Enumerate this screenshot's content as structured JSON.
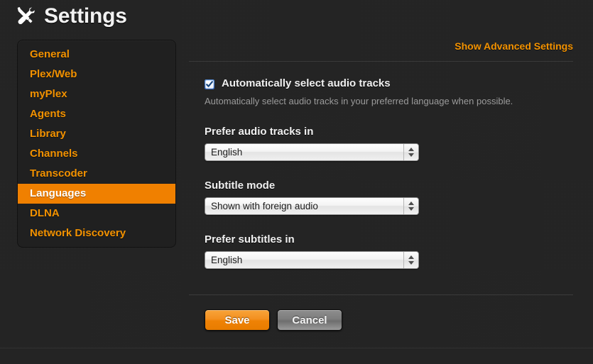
{
  "header": {
    "icon": "tools-icon",
    "title": "Settings"
  },
  "sidebar": {
    "items": [
      {
        "label": "General",
        "active": false
      },
      {
        "label": "Plex/Web",
        "active": false
      },
      {
        "label": "myPlex",
        "active": false
      },
      {
        "label": "Agents",
        "active": false
      },
      {
        "label": "Library",
        "active": false
      },
      {
        "label": "Channels",
        "active": false
      },
      {
        "label": "Transcoder",
        "active": false
      },
      {
        "label": "Languages",
        "active": true
      },
      {
        "label": "DLNA",
        "active": false
      },
      {
        "label": "Network Discovery",
        "active": false
      }
    ]
  },
  "content": {
    "advanced_link": "Show Advanced Settings",
    "auto_audio": {
      "label": "Automatically select audio tracks",
      "checked": true,
      "help": "Automatically select audio tracks in your preferred language when possible."
    },
    "fields": [
      {
        "label": "Prefer audio tracks in",
        "value": "English",
        "name": "prefer-audio-tracks"
      },
      {
        "label": "Subtitle mode",
        "value": "Shown with foreign audio",
        "name": "subtitle-mode"
      },
      {
        "label": "Prefer subtitles in",
        "value": "English",
        "name": "prefer-subtitles"
      }
    ],
    "buttons": {
      "save": "Save",
      "cancel": "Cancel"
    }
  },
  "colors": {
    "accent_orange": "#f39200",
    "active_orange": "#f08000",
    "page_bg": "#222222",
    "panel_bg": "#202020",
    "divider": "#3a3a3a",
    "help_text": "#9b9b9b"
  }
}
